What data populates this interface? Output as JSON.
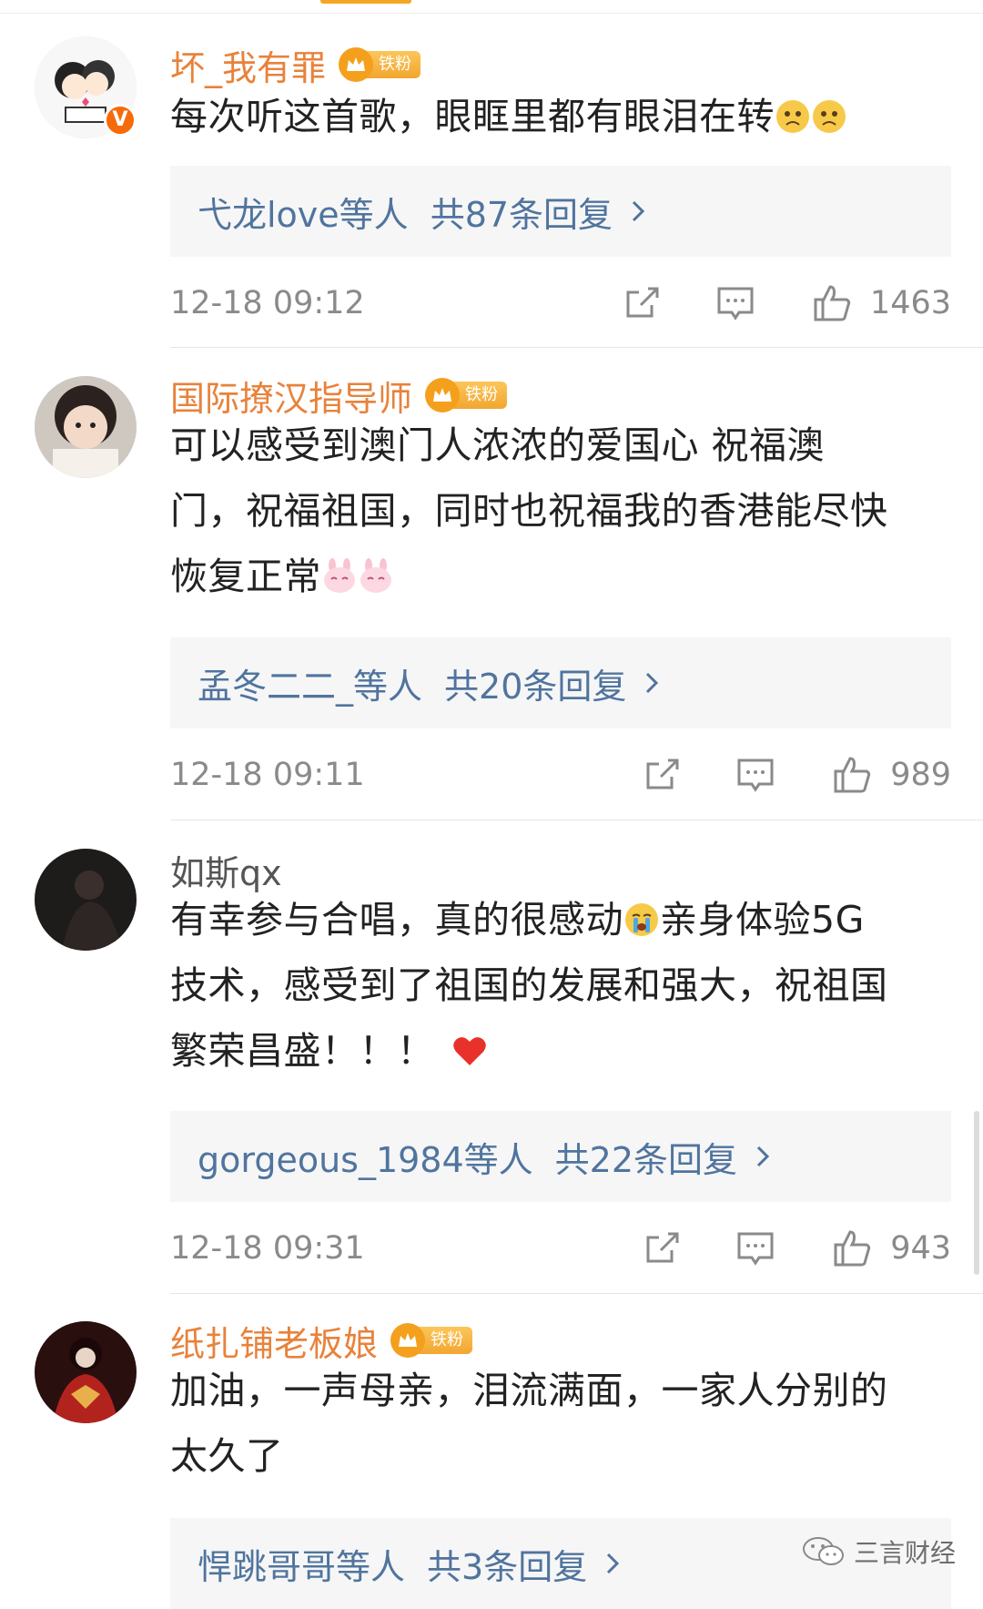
{
  "colors": {
    "username_highlight": "#e8823b",
    "reply_link": "#50749e",
    "meta_gray": "#8a8a8a",
    "fan_badge": "#f4a01c",
    "reply_bg": "#f6f6f6"
  },
  "comments": [
    {
      "username": "坏_我有罪",
      "fan_badge": "铁粉",
      "verified_badge": "V",
      "text": "每次听这首歌，眼眶里都有眼泪在转",
      "emojis": [
        "sad-face-emoji",
        "sad-face-emoji"
      ],
      "reply_users": "弋龙love等人",
      "reply_count": "共87条回复",
      "timestamp": "12-18 09:12",
      "likes": "1463"
    },
    {
      "username": "国际撩汉指导师",
      "fan_badge": "铁粉",
      "text_lines": [
        "可以感受到澳门人浓浓的爱国心 祝福澳",
        "门，祝福祖国，同时也祝福我的香港能尽快",
        "恢复正常"
      ],
      "emojis": [
        "bunny-emoji",
        "bunny-emoji"
      ],
      "reply_users": "孟冬二二_等人",
      "reply_count": "共20条回复",
      "timestamp": "12-18 09:11",
      "likes": "989"
    },
    {
      "username": "如斯qx",
      "text_lines": [
        "有幸参与合唱，真的很感动",
        "亲身体验5G",
        "技术，感受到了祖国的发展和强大，祝祖国",
        "繁荣昌盛！！！"
      ],
      "emojis": [
        "crying-face-emoji",
        "red-heart-emoji"
      ],
      "reply_users": "gorgeous_1984等人",
      "reply_count": "共22条回复",
      "timestamp": "12-18 09:31",
      "likes": "943"
    },
    {
      "username": "纸扎铺老板娘",
      "fan_badge": "铁粉",
      "text_lines": [
        "加油，一声母亲，泪流满面，一家人分别的",
        "太久了"
      ],
      "reply_users": "悍跳哥哥等人",
      "reply_count": "共3条回复"
    }
  ],
  "watermark": {
    "label": "三言财经",
    "icon": "wechat-icon"
  }
}
